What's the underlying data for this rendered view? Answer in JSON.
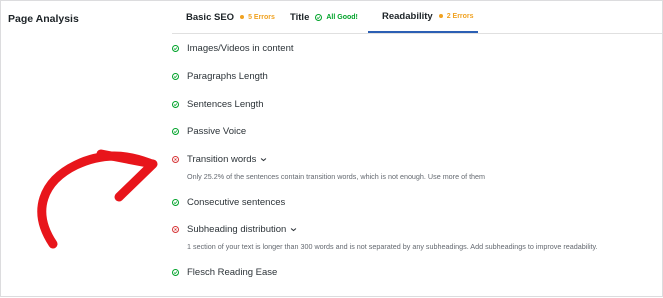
{
  "panel": {
    "title": "Page Analysis"
  },
  "tabs": [
    {
      "label": "Basic SEO",
      "status": "5 Errors",
      "status_color": "#f0a221",
      "active": false
    },
    {
      "label": "Title",
      "status": "All Good!",
      "status_color": "#00a32a",
      "active": false
    },
    {
      "label": "Readability",
      "status": "2 Errors",
      "status_color": "#f0a221",
      "active": true
    }
  ],
  "checks": [
    {
      "label": "Images/Videos in content",
      "state": "pass"
    },
    {
      "label": "Paragraphs Length",
      "state": "pass"
    },
    {
      "label": "Sentences Length",
      "state": "pass"
    },
    {
      "label": "Passive Voice",
      "state": "pass"
    },
    {
      "label": "Transition words",
      "state": "fail",
      "expandable": true,
      "description": "Only 25.2% of the sentences contain transition words, which is not enough. Use more of them"
    },
    {
      "label": "Consecutive sentences",
      "state": "pass"
    },
    {
      "label": "Subheading distribution",
      "state": "fail",
      "expandable": true,
      "description": "1 section of your text is longer than 300 words and is not separated by any subheadings. Add subheadings to improve readability."
    },
    {
      "label": "Flesch Reading Ease",
      "state": "pass"
    }
  ],
  "colors": {
    "pass": "#00a32a",
    "fail": "#d63638",
    "warning": "#f0a221",
    "accent": "#2b5fb4",
    "annotation_arrow": "#e8151b"
  },
  "icons": {
    "pass": "check-circle-icon",
    "fail": "x-circle-icon",
    "expand": "chevron-down-icon"
  }
}
